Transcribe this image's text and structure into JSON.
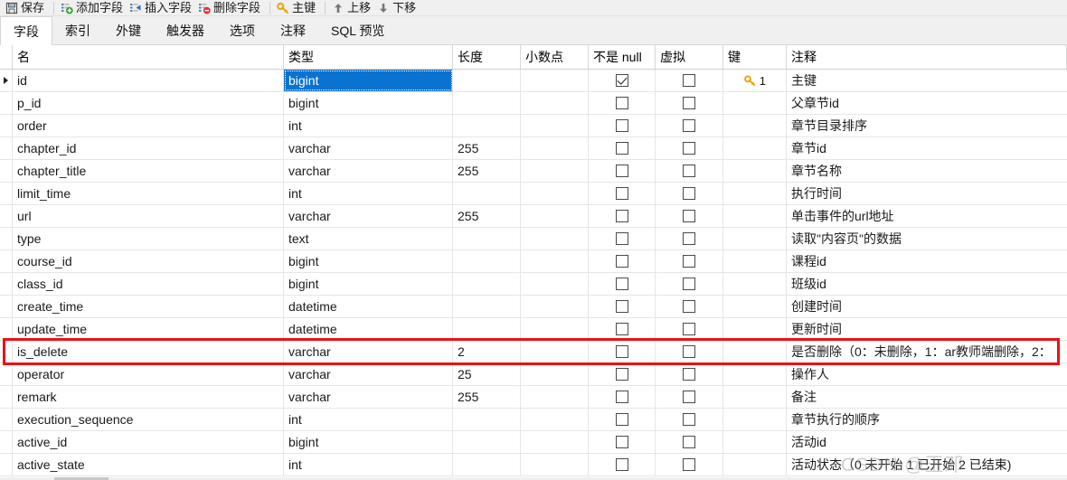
{
  "toolbar": {
    "buttons": [
      {
        "label": "保存",
        "icon": "save-icon"
      },
      {
        "label": "添加字段",
        "icon": "add-field-icon"
      },
      {
        "label": "插入字段",
        "icon": "insert-field-icon"
      },
      {
        "label": "删除字段",
        "icon": "delete-field-icon"
      },
      {
        "label": "主键",
        "icon": "primary-key-icon"
      },
      {
        "label": "上移",
        "icon": "move-up-icon"
      },
      {
        "label": "下移",
        "icon": "move-down-icon"
      }
    ]
  },
  "tabs": [
    {
      "label": "字段",
      "active": true
    },
    {
      "label": "索引",
      "active": false
    },
    {
      "label": "外键",
      "active": false
    },
    {
      "label": "触发器",
      "active": false
    },
    {
      "label": "选项",
      "active": false
    },
    {
      "label": "注释",
      "active": false
    },
    {
      "label": "SQL 预览",
      "active": false
    }
  ],
  "grid": {
    "columns": [
      "名",
      "类型",
      "长度",
      "小数点",
      "不是 null",
      "虚拟",
      "键",
      "注释"
    ],
    "selected_cell": {
      "row": 0,
      "column": "类型"
    },
    "rows": [
      {
        "name": "id",
        "type": "bigint",
        "length": "",
        "decimals": "",
        "not_null": true,
        "virtual": false,
        "key": "1",
        "comment": "主键",
        "current": true
      },
      {
        "name": "p_id",
        "type": "bigint",
        "length": "",
        "decimals": "",
        "not_null": false,
        "virtual": false,
        "key": "",
        "comment": "父章节id",
        "current": false
      },
      {
        "name": "order",
        "type": "int",
        "length": "",
        "decimals": "",
        "not_null": false,
        "virtual": false,
        "key": "",
        "comment": "章节目录排序",
        "current": false
      },
      {
        "name": "chapter_id",
        "type": "varchar",
        "length": "255",
        "decimals": "",
        "not_null": false,
        "virtual": false,
        "key": "",
        "comment": "章节id",
        "current": false
      },
      {
        "name": "chapter_title",
        "type": "varchar",
        "length": "255",
        "decimals": "",
        "not_null": false,
        "virtual": false,
        "key": "",
        "comment": " 章节名称",
        "current": false
      },
      {
        "name": "limit_time",
        "type": "int",
        "length": "",
        "decimals": "",
        "not_null": false,
        "virtual": false,
        "key": "",
        "comment": " 执行时间",
        "current": false
      },
      {
        "name": "url",
        "type": "varchar",
        "length": "255",
        "decimals": "",
        "not_null": false,
        "virtual": false,
        "key": "",
        "comment": " 单击事件的url地址",
        "current": false
      },
      {
        "name": "type",
        "type": "text",
        "length": "",
        "decimals": "",
        "not_null": false,
        "virtual": false,
        "key": "",
        "comment": "读取\"内容页\"的数据",
        "current": false
      },
      {
        "name": "course_id",
        "type": "bigint",
        "length": "",
        "decimals": "",
        "not_null": false,
        "virtual": false,
        "key": "",
        "comment": "课程id",
        "current": false
      },
      {
        "name": "class_id",
        "type": "bigint",
        "length": "",
        "decimals": "",
        "not_null": false,
        "virtual": false,
        "key": "",
        "comment": "班级id",
        "current": false
      },
      {
        "name": "create_time",
        "type": "datetime",
        "length": "",
        "decimals": "",
        "not_null": false,
        "virtual": false,
        "key": "",
        "comment": "创建时间",
        "current": false
      },
      {
        "name": "update_time",
        "type": "datetime",
        "length": "",
        "decimals": "",
        "not_null": false,
        "virtual": false,
        "key": "",
        "comment": "更新时间",
        "current": false
      },
      {
        "name": "is_delete",
        "type": "varchar",
        "length": "2",
        "decimals": "",
        "not_null": false,
        "virtual": false,
        "key": "",
        "comment": "是否删除（0：未删除，1：ar教师端删除，2：",
        "current": false,
        "highlighted": true
      },
      {
        "name": "operator",
        "type": "varchar",
        "length": "25",
        "decimals": "",
        "not_null": false,
        "virtual": false,
        "key": "",
        "comment": "操作人",
        "current": false
      },
      {
        "name": "remark",
        "type": "varchar",
        "length": "255",
        "decimals": "",
        "not_null": false,
        "virtual": false,
        "key": "",
        "comment": "备注",
        "current": false
      },
      {
        "name": "execution_sequence",
        "type": "int",
        "length": "",
        "decimals": "",
        "not_null": false,
        "virtual": false,
        "key": "",
        "comment": "章节执行的顺序",
        "current": false
      },
      {
        "name": "active_id",
        "type": "bigint",
        "length": "",
        "decimals": "",
        "not_null": false,
        "virtual": false,
        "key": "",
        "comment": "活动id",
        "current": false
      },
      {
        "name": "active_state",
        "type": "int",
        "length": "",
        "decimals": "",
        "not_null": false,
        "virtual": false,
        "key": "",
        "comment": "活动状态（0 未开始 1 已开始 2 已结束)",
        "current": false
      }
    ]
  },
  "watermark": {
    "text": "CSDN @王邓"
  },
  "colors": {
    "selection": "#0a72d0",
    "annotation": "#ee1111",
    "key_icon": "#e8a60c",
    "toolbar_bg": "#f0f0f0"
  }
}
